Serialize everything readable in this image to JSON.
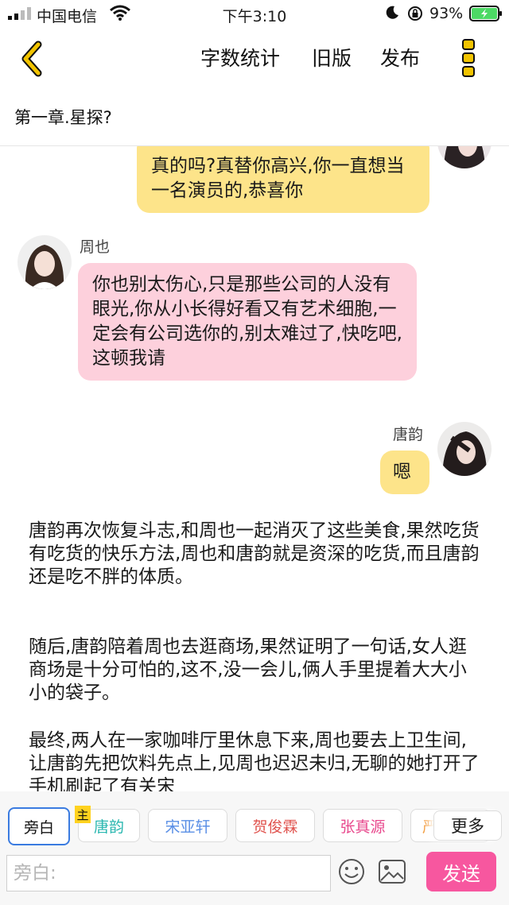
{
  "status_bar": {
    "carrier": "中国电信",
    "time": "下午3:10",
    "battery_percent": "93%"
  },
  "header": {
    "word_count_label": "字数统计",
    "old_version_label": "旧版",
    "publish_label": "发布"
  },
  "chapter_title": "第一章.星探?",
  "messages": [
    {
      "speaker": "",
      "side": "right",
      "color": "#fde48a",
      "text": "真的吗?真替你高兴,你一直想当一名演员的,恭喜你"
    },
    {
      "speaker": "周也",
      "side": "left",
      "color": "#fdd0dc",
      "text": "你也别太伤心,只是那些公司的人没有眼光,你从小长得好看又有艺术细胞,一定会有公司选你的,别太难过了,快吃吧,这顿我请"
    },
    {
      "speaker": "唐韵",
      "side": "right",
      "color": "#fde48a",
      "text": "嗯"
    }
  ],
  "narration": [
    "唐韵再次恢复斗志,和周也一起消灭了这些美食,果然吃货有吃货的快乐方法,周也和唐韵就是资深的吃货,而且唐韵还是吃不胖的体质。",
    "随后,唐韵陪着周也去逛商场,果然证明了一句话,女人逛商场是十分可怕的,这不,没一会儿,俩人手里提着大大小小的袋子。",
    "最终,两人在一家咖啡厅里休息下来,周也要去上卫生间,让唐韵先把饮料先点上,见周也迟迟未归,无聊的她打开了手机刷起了有关宋"
  ],
  "roles": [
    {
      "label": "旁白",
      "color": "#111111",
      "active": true
    },
    {
      "label": "唐韵",
      "color": "#2ab7b0",
      "active": false
    },
    {
      "label": "宋亚轩",
      "color": "#5a8fe6",
      "active": false
    },
    {
      "label": "贺俊霖",
      "color": "#e0534e",
      "active": false
    },
    {
      "label": "张真源",
      "color": "#e8498d",
      "active": false
    },
    {
      "label": "严",
      "color": "#f29a3a",
      "active": false
    }
  ],
  "main_badge": "主",
  "more_roles_label": "更多",
  "input": {
    "placeholder": "旁白:"
  },
  "send_label": "发送",
  "icons": {
    "back": "chevron-left-icon",
    "more": "vertical-dots-icon",
    "emoji": "smiley-icon",
    "image": "image-icon"
  },
  "colors": {
    "accent_yellow": "#f2c400",
    "send_pink": "#f7579f",
    "active_blue": "#3a7be0"
  }
}
